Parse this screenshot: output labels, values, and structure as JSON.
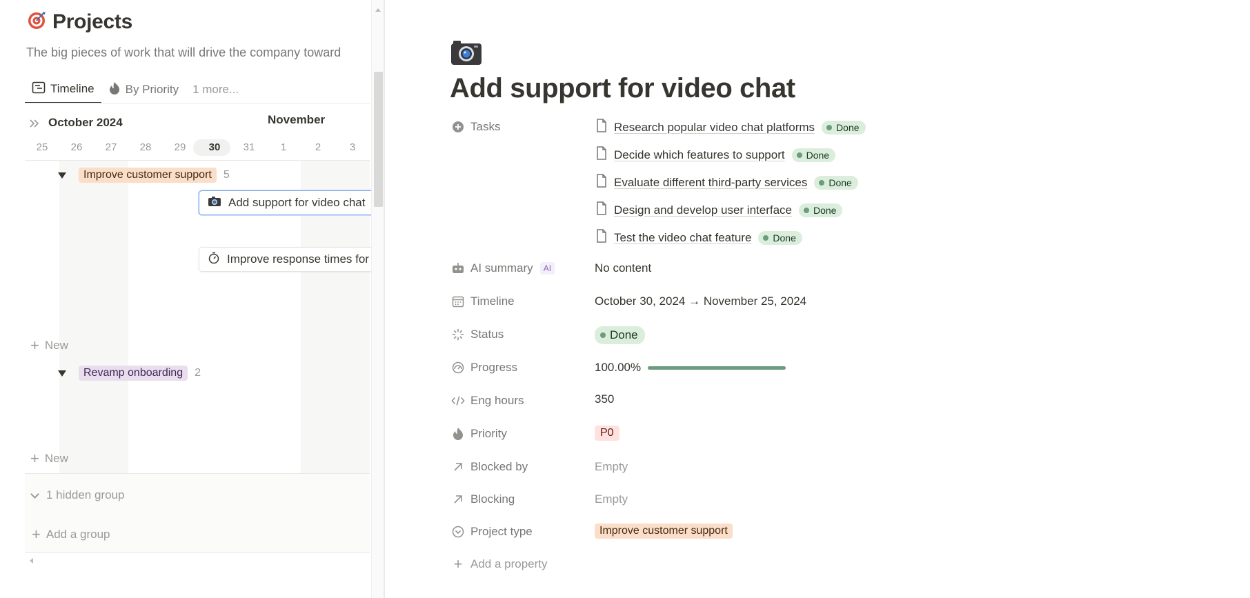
{
  "left": {
    "title": "Projects",
    "description": "The big pieces of work that will drive the company toward",
    "tabs": [
      {
        "label": "Timeline",
        "icon": "timeline-icon",
        "active": true
      },
      {
        "label": "By Priority",
        "icon": "flame-icon",
        "active": false
      },
      {
        "label": "1 more...",
        "icon": "",
        "active": false
      }
    ],
    "timeline": {
      "month_current": "October 2024",
      "month_next": "November",
      "days": [
        "25",
        "26",
        "27",
        "28",
        "29",
        "30",
        "31",
        "1",
        "2",
        "3"
      ],
      "today": "30"
    },
    "groups": [
      {
        "name": "Improve customer support",
        "count": "5",
        "cards": [
          {
            "label": "Add support for video chat",
            "icon": "camera-icon",
            "selected": true
          },
          {
            "label": "Improve response times for",
            "icon": "stopwatch-icon",
            "selected": false
          }
        ]
      },
      {
        "name": "Revamp onboarding",
        "count": "2",
        "cards": []
      }
    ],
    "new_label": "New",
    "hidden_groups": "1 hidden group",
    "add_group": "Add a group"
  },
  "doc": {
    "icon": "camera-icon",
    "title": "Add support for video chat",
    "properties": {
      "tasks_label": "Tasks",
      "tasks": [
        {
          "name": "Research popular video chat platforms",
          "status": "Done"
        },
        {
          "name": "Decide which features to support",
          "status": "Done"
        },
        {
          "name": "Evaluate different third-party services",
          "status": "Done"
        },
        {
          "name": "Design and develop user interface",
          "status": "Done"
        },
        {
          "name": "Test the video chat feature",
          "status": "Done"
        }
      ],
      "ai_summary_label": "AI summary",
      "ai_badge": "AI",
      "ai_summary_value": "No content",
      "timeline_label": "Timeline",
      "timeline_value": "October 30, 2024 → November 25, 2024",
      "status_label": "Status",
      "status_value": "Done",
      "progress_label": "Progress",
      "progress_value": "100.00%",
      "progress_fraction": 1.0,
      "eng_hours_label": "Eng hours",
      "eng_hours_value": "350",
      "priority_label": "Priority",
      "priority_value": "P0",
      "blocked_by_label": "Blocked by",
      "blocked_by_value": "Empty",
      "blocking_label": "Blocking",
      "blocking_value": "Empty",
      "project_type_label": "Project type",
      "project_type_value": "Improve customer support",
      "add_property": "Add a property"
    }
  },
  "colors": {
    "done_green": "#6c9b7d",
    "done_bg": "#dbeddb",
    "orange_tag_bg": "#fadec9",
    "purple_tag_bg": "#e8deee",
    "p0_bg": "#ffe2dd",
    "selection_blue": "#7fa6e6"
  }
}
